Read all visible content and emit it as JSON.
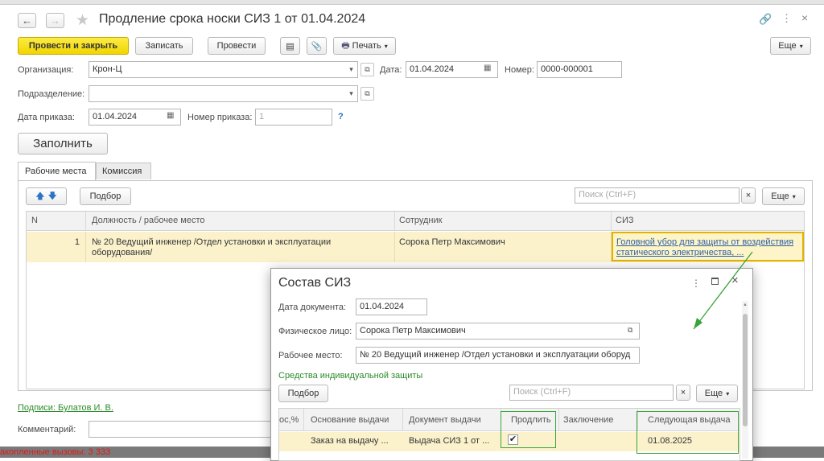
{
  "window": {
    "title": "Продление срока носки СИЗ 1 от 01.04.2024",
    "link_icon": "link-icon",
    "more_icon": "more-vertical-icon",
    "close_icon": "close-icon"
  },
  "toolbar": {
    "post_close": "Провести и закрыть",
    "save": "Записать",
    "post": "Провести",
    "print": "Печать",
    "more": "Еще"
  },
  "header": {
    "org_label": "Организация:",
    "org_value": "Крон-Ц",
    "date_label": "Дата:",
    "date_value": "01.04.2024",
    "number_label": "Номер:",
    "number_value": "0000-000001",
    "dept_label": "Подразделение:",
    "dept_value": "",
    "order_date_label": "Дата приказа:",
    "order_date_value": "01.04.2024",
    "order_number_label": "Номер приказа:",
    "order_number_value": "1",
    "help": "?",
    "fill_button": "Заполнить"
  },
  "tabs": [
    {
      "label": "Рабочие места"
    },
    {
      "label": "Комиссия"
    }
  ],
  "table_toolbar": {
    "select": "Подбор",
    "search_placeholder": "Поиск (Ctrl+F)",
    "clear": "×",
    "more": "Еще"
  },
  "table": {
    "columns": [
      "N",
      "Должность / рабочее место",
      "Сотрудник",
      "СИЗ"
    ],
    "rows": [
      {
        "n": "1",
        "position_line1": "№ 20 Ведущий инженер /Отдел установки и эксплуатации",
        "position_line2": "оборудования/",
        "employee": "Сорока Петр Максимович",
        "siz_line1": "Головной убор для защиты от воздействия",
        "siz_line2": "статического электричества, ..."
      }
    ]
  },
  "footer": {
    "signatures": "Подписи: Булатов И. В.",
    "comment_label": "Комментарий:",
    "status": "акопленные вызовы: 3 333"
  },
  "dialog": {
    "title": "Состав СИЗ",
    "doc_date_label": "Дата документа:",
    "doc_date_value": "01.04.2024",
    "person_label": "Физическое лицо:",
    "person_value": "Сорока Петр Максимович",
    "workplace_label": "Рабочее место:",
    "workplace_value": "№ 20 Ведущий инженер /Отдел установки и эксплуатации оборуд",
    "section_label": "Средства индивидуальной защиты",
    "select": "Подбор",
    "search_placeholder": "Поиск (Ctrl+F)",
    "clear": "×",
    "more": "Еще",
    "columns": [
      "ос,%",
      "Основание выдачи",
      "Документ выдачи",
      "Продлить",
      "Заключение",
      "Следующая выдача"
    ],
    "rows": [
      {
        "pct": "",
        "basis": "Заказ на выдачу ...",
        "document": "Выдача СИЗ 1 от ...",
        "extend": true,
        "conclusion": "",
        "next_issue": "01.08.2025"
      }
    ]
  },
  "colors": {
    "accent_yellow": "#f5dc1e",
    "row_highlight": "#fbf2cc",
    "annotation_green": "#3aa43a",
    "link_blue": "#2b5fa8"
  }
}
